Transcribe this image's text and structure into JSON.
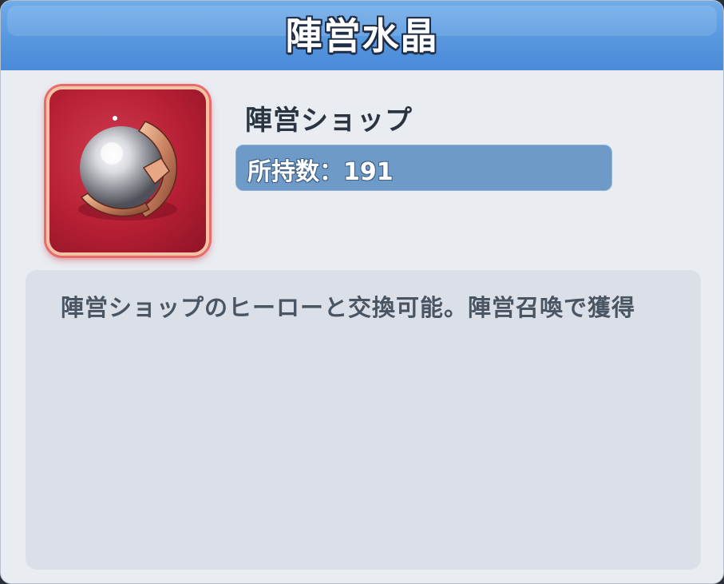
{
  "dialog": {
    "title": "陣営水晶"
  },
  "item": {
    "icon": "crystal-orb-icon",
    "name": "陣営ショップ",
    "count_label": "所持数：",
    "count_value": "191",
    "description": "陣営ショップのヒーローと交換可能。陣営召喚で獲得"
  },
  "colors": {
    "header_blue": "#5b9be0",
    "icon_frame_red": "#b61f34",
    "count_bar": "#6e9ac7",
    "panel_bg": "#e9ecf1"
  }
}
